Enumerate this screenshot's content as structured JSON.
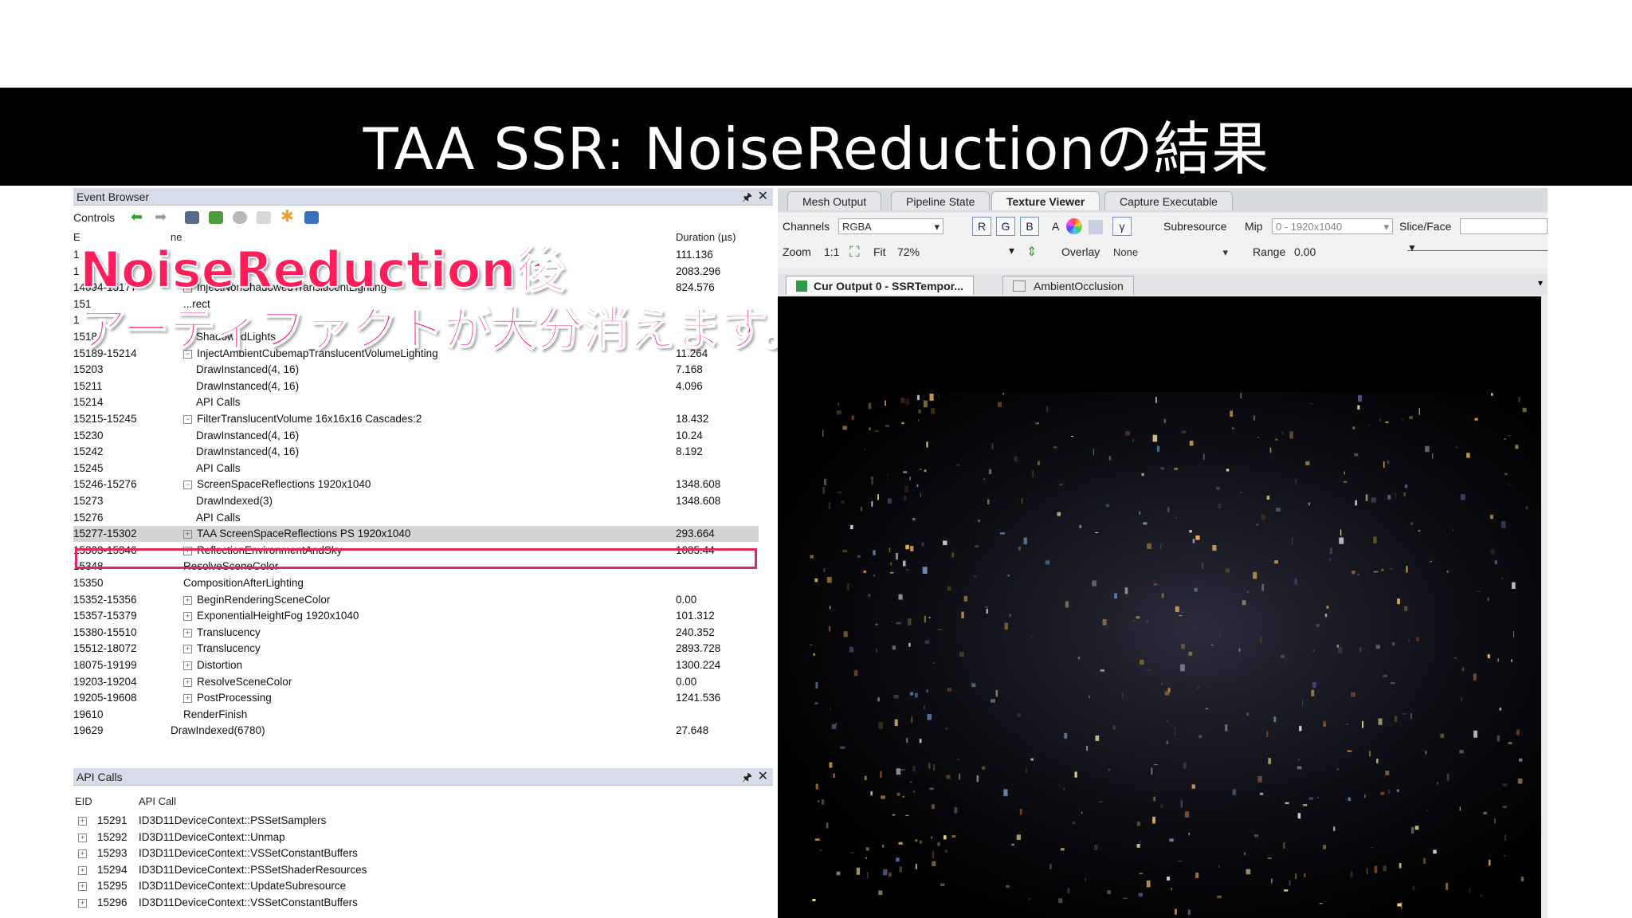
{
  "slide": {
    "title": "TAA SSR: NoiseReductionの結果"
  },
  "event_browser": {
    "title": "Event Browser",
    "controls_label": "Controls",
    "pin": "🖈",
    "close": "✕",
    "columns": {
      "eid": "E",
      "name": "ne",
      "duration": "Duration (µs)"
    },
    "rows": [
      {
        "eid": "1",
        "name": "",
        "duration": "111.136",
        "indent": 0,
        "expander": ""
      },
      {
        "eid": "1",
        "name": "",
        "duration": "2083.296",
        "indent": 0,
        "expander": ""
      },
      {
        "eid": "14094-15177",
        "name": "InjectNonShadowedTranslucentLighting",
        "duration": "824.576",
        "indent": 1,
        "expander": "+"
      },
      {
        "eid": "151",
        "name": "...rect",
        "duration": "",
        "indent": 1,
        "expander": ""
      },
      {
        "eid": "1",
        "name": "",
        "duration": "",
        "indent": 1,
        "expander": ""
      },
      {
        "eid": "15185",
        "name": "ShadowedLights",
        "duration": "",
        "indent": 2,
        "expander": ""
      },
      {
        "eid": "15189-15214",
        "name": "InjectAmbientCubemapTranslucentVolumeLighting",
        "duration": "11.264",
        "indent": 1,
        "expander": "−"
      },
      {
        "eid": "15203",
        "name": "DrawInstanced(4, 16)",
        "duration": "7.168",
        "indent": 2,
        "expander": ""
      },
      {
        "eid": "15211",
        "name": "DrawInstanced(4, 16)",
        "duration": "4.096",
        "indent": 2,
        "expander": ""
      },
      {
        "eid": "15214",
        "name": "API Calls",
        "duration": "",
        "indent": 2,
        "expander": ""
      },
      {
        "eid": "15215-15245",
        "name": "FilterTranslucentVolume 16x16x16 Cascades:2",
        "duration": "18.432",
        "indent": 1,
        "expander": "−"
      },
      {
        "eid": "15230",
        "name": "DrawInstanced(4, 16)",
        "duration": "10.24",
        "indent": 2,
        "expander": ""
      },
      {
        "eid": "15242",
        "name": "DrawInstanced(4, 16)",
        "duration": "8.192",
        "indent": 2,
        "expander": ""
      },
      {
        "eid": "15245",
        "name": "API Calls",
        "duration": "",
        "indent": 2,
        "expander": ""
      },
      {
        "eid": "15246-15276",
        "name": "ScreenSpaceReflections 1920x1040",
        "duration": "1348.608",
        "indent": 1,
        "expander": "−"
      },
      {
        "eid": "15273",
        "name": "DrawIndexed(3)",
        "duration": "1348.608",
        "indent": 2,
        "expander": ""
      },
      {
        "eid": "15276",
        "name": "API Calls",
        "duration": "",
        "indent": 2,
        "expander": ""
      },
      {
        "eid": "15277-15302",
        "name": "TAA ScreenSpaceReflections PS 1920x1040",
        "duration": "293.664",
        "indent": 1,
        "expander": "+",
        "selected": true
      },
      {
        "eid": "15303-15346",
        "name": "ReflectionEnvironmentAndSky",
        "duration": "1085.44",
        "indent": 1,
        "expander": "+"
      },
      {
        "eid": "15348",
        "name": "ResolveSceneColor",
        "duration": "",
        "indent": 1,
        "expander": ""
      },
      {
        "eid": "15350",
        "name": "CompositionAfterLighting",
        "duration": "",
        "indent": 1,
        "expander": ""
      },
      {
        "eid": "15352-15356",
        "name": "BeginRenderingSceneColor",
        "duration": "0.00",
        "indent": 1,
        "expander": "+"
      },
      {
        "eid": "15357-15379",
        "name": "ExponentialHeightFog 1920x1040",
        "duration": "101.312",
        "indent": 1,
        "expander": "+"
      },
      {
        "eid": "15380-15510",
        "name": "Translucency",
        "duration": "240.352",
        "indent": 1,
        "expander": "+"
      },
      {
        "eid": "15512-18072",
        "name": "Translucency",
        "duration": "2893.728",
        "indent": 1,
        "expander": "+"
      },
      {
        "eid": "18075-19199",
        "name": "Distortion",
        "duration": "1300.224",
        "indent": 1,
        "expander": "+"
      },
      {
        "eid": "19203-19204",
        "name": "ResolveSceneColor",
        "duration": "0.00",
        "indent": 1,
        "expander": "+"
      },
      {
        "eid": "19205-19608",
        "name": "PostProcessing",
        "duration": "1241.536",
        "indent": 1,
        "expander": "+"
      },
      {
        "eid": "19610",
        "name": "RenderFinish",
        "duration": "",
        "indent": 1,
        "expander": ""
      },
      {
        "eid": "19629",
        "name": "DrawIndexed(6780)",
        "duration": "27.648",
        "indent": 0,
        "expander": ""
      }
    ]
  },
  "annotation": {
    "line1": "NoiseReduction後",
    "line2": "アーティファクトが大分消えます。",
    "color": "#ff1e5a"
  },
  "api_calls": {
    "title": "API Calls",
    "columns": {
      "eid": "EID",
      "call": "API Call"
    },
    "rows": [
      {
        "eid": "15291",
        "call": "ID3D11DeviceContext::PSSetSamplers"
      },
      {
        "eid": "15292",
        "call": "ID3D11DeviceContext::Unmap"
      },
      {
        "eid": "15293",
        "call": "ID3D11DeviceContext::VSSetConstantBuffers"
      },
      {
        "eid": "15294",
        "call": "ID3D11DeviceContext::PSSetShaderResources"
      },
      {
        "eid": "15295",
        "call": "ID3D11DeviceContext::UpdateSubresource"
      },
      {
        "eid": "15296",
        "call": "ID3D11DeviceContext::VSSetConstantBuffers"
      }
    ]
  },
  "texture_viewer": {
    "tabs": [
      "Mesh Output",
      "Pipeline State",
      "Texture Viewer",
      "Capture Executable"
    ],
    "active_tab": "Texture Viewer",
    "channels_label": "Channels",
    "channels_value": "RGBA",
    "channel_buttons": [
      "R",
      "G",
      "B"
    ],
    "alpha_label": "A",
    "gamma_label": "γ",
    "subresource_label": "Subresource",
    "mip_label": "Mip",
    "mip_value": "0 - 1920x1040",
    "slice_label": "Slice/Face",
    "zoom_label": "Zoom",
    "zoom_ratio": "1:1",
    "fit_label": "Fit",
    "zoom_value": "72%",
    "overlay_label": "Overlay",
    "overlay_value": "None",
    "range_label": "Range",
    "range_value": "0.00",
    "subtabs": [
      "Cur Output 0 - SSRTempor...",
      "AmbientOcclusion"
    ]
  }
}
